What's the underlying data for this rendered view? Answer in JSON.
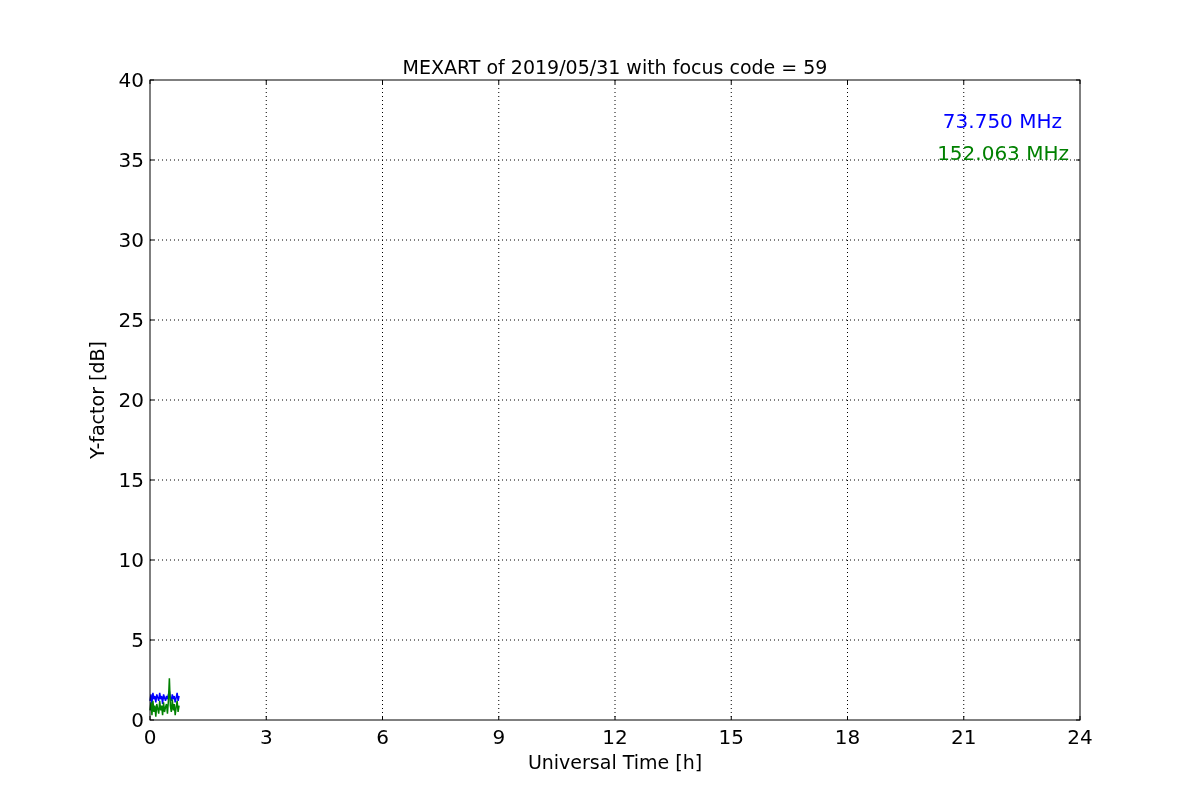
{
  "chart_data": {
    "type": "line",
    "title": "MEXART of 2019/05/31 with focus code = 59",
    "xlabel": "Universal Time [h]",
    "ylabel": "Y-factor [dB]",
    "x": [
      0,
      0.025,
      0.05,
      0.075,
      0.1,
      0.125,
      0.15,
      0.175,
      0.2,
      0.225,
      0.25,
      0.275,
      0.3,
      0.325,
      0.35,
      0.375,
      0.4,
      0.425,
      0.45,
      0.475,
      0.5,
      0.525,
      0.55,
      0.575,
      0.6,
      0.625,
      0.65,
      0.675,
      0.7,
      0.725,
      0.75
    ],
    "series": [
      {
        "name": "73.750 MHz",
        "color": "#0000ff",
        "values": [
          1.2,
          1.6,
          1.0,
          1.7,
          1.3,
          1.5,
          1.1,
          1.6,
          1.4,
          1.2,
          1.7,
          1.3,
          1.5,
          1.0,
          1.6,
          1.4,
          1.2,
          1.5,
          1.3,
          1.6,
          1.8,
          1.4,
          1.2,
          1.6,
          1.3,
          1.5,
          1.1,
          1.4,
          1.7,
          1.2,
          1.5
        ]
      },
      {
        "name": "152.063 MHz",
        "color": "#008000",
        "values": [
          0.6,
          1.1,
          0.3,
          1.2,
          0.5,
          0.9,
          0.2,
          1.0,
          0.7,
          0.4,
          1.2,
          0.6,
          0.9,
          0.3,
          1.1,
          0.5,
          0.8,
          1.0,
          0.4,
          1.2,
          2.6,
          0.9,
          0.5,
          1.3,
          0.6,
          1.0,
          0.3,
          0.8,
          1.2,
          0.5,
          0.9
        ]
      }
    ],
    "grid": true,
    "xlim": [
      0,
      24
    ],
    "ylim": [
      0,
      40
    ],
    "xticks": [
      0,
      3,
      6,
      9,
      12,
      15,
      18,
      21,
      24
    ],
    "yticks": [
      0,
      5,
      10,
      15,
      20,
      25,
      30,
      35,
      40
    ]
  }
}
